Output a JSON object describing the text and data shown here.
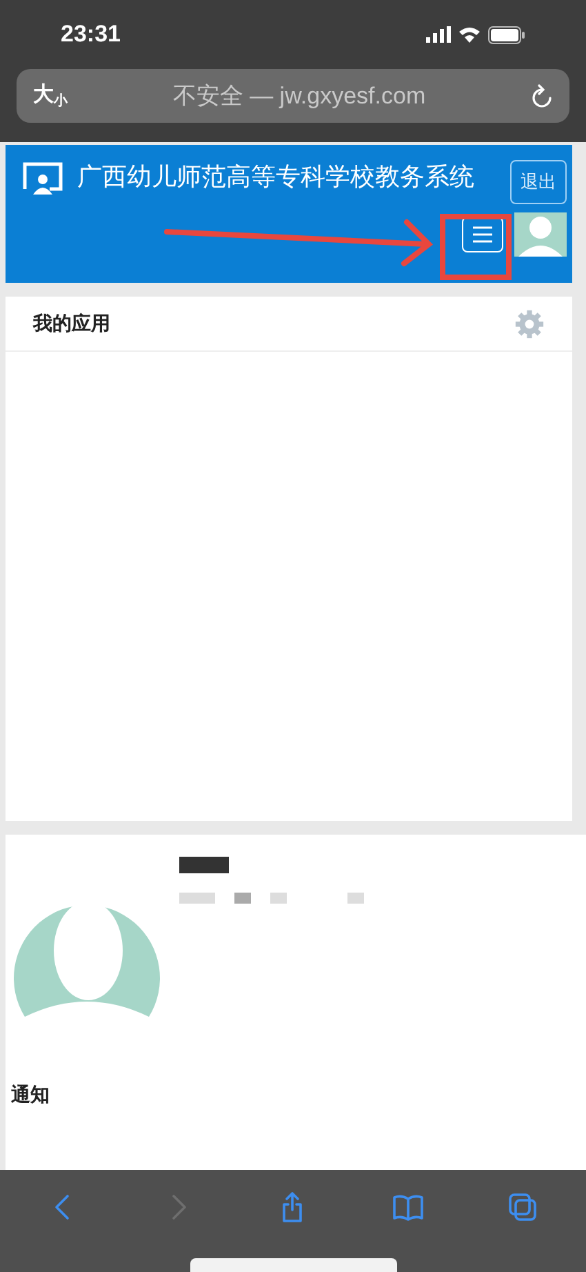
{
  "status_bar": {
    "time": "23:31"
  },
  "address_bar": {
    "text_size_large": "大",
    "text_size_small": "小",
    "url": "不安全 — jw.gxyesf.com"
  },
  "header": {
    "title": "广西幼儿师范高等专科学校教务系统",
    "logout": "退出"
  },
  "apps_panel": {
    "title": "我的应用"
  },
  "notice": {
    "title": "通知"
  },
  "toolbar": [
    {
      "kind": "back",
      "disabled": false
    },
    {
      "kind": "forward",
      "disabled": true
    },
    {
      "kind": "share",
      "disabled": false
    },
    {
      "kind": "bookmarks",
      "disabled": false
    },
    {
      "kind": "tabs",
      "disabled": false
    }
  ]
}
